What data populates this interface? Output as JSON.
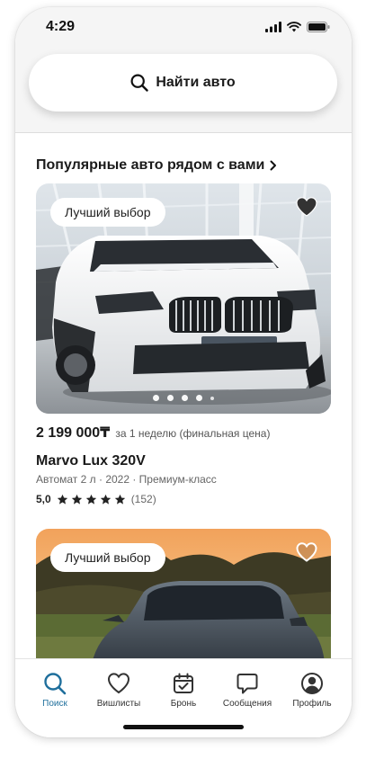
{
  "status_bar": {
    "time": "4:29"
  },
  "search": {
    "label": "Найти авто"
  },
  "section": {
    "title": "Популярные авто рядом с вами"
  },
  "listings": [
    {
      "badge": "Лучший выбор",
      "favorited": true,
      "carousel": {
        "active_index": 0,
        "dot_count": 5
      },
      "price": "2 199 000₸",
      "price_note": "за 1 неделю (финальная цена)",
      "name": "Marvo Lux 320V",
      "meta": "Автомат 2 л · 2022 · Премиум-класс",
      "rating": "5,0",
      "stars": 5,
      "reviews": "(152)"
    },
    {
      "badge": "Лучший выбор",
      "favorited": false
    }
  ],
  "tabs": [
    {
      "label": "Поиск",
      "icon": "search-icon",
      "active": true
    },
    {
      "label": "Вишлисты",
      "icon": "heart-icon",
      "active": false
    },
    {
      "label": "Бронь",
      "icon": "calendar-check-icon",
      "active": false
    },
    {
      "label": "Сообщения",
      "icon": "chat-icon",
      "active": false
    },
    {
      "label": "Профиль",
      "icon": "profile-icon",
      "active": false
    }
  ],
  "colors": {
    "accent": "#1f6f9c",
    "text": "#1a1a1a",
    "background": "#f5f5f5"
  }
}
